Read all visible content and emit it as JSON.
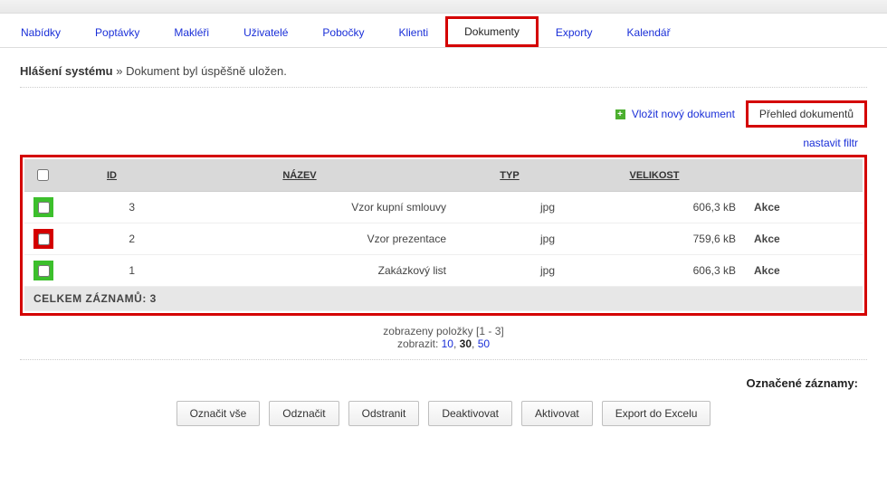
{
  "nav": {
    "items": [
      {
        "label": "Nabídky",
        "active": false
      },
      {
        "label": "Poptávky",
        "active": false
      },
      {
        "label": "Makléři",
        "active": false
      },
      {
        "label": "Uživatelé",
        "active": false
      },
      {
        "label": "Pobočky",
        "active": false
      },
      {
        "label": "Klienti",
        "active": false
      },
      {
        "label": "Dokumenty",
        "active": true
      },
      {
        "label": "Exporty",
        "active": false
      },
      {
        "label": "Kalendář",
        "active": false
      }
    ]
  },
  "sysmsg": {
    "title": "Hlášení systému",
    "sep": " » ",
    "text": "Dokument byl úspěšně uložen."
  },
  "top_actions": {
    "new_doc": "Vložit nový dokument",
    "overview": "Přehled dokumentů"
  },
  "filter": {
    "label": "nastavit filtr"
  },
  "columns": {
    "id": "ID",
    "name": "NÁZEV",
    "type": "TYP",
    "size": "VELIKOST",
    "action": "Akce"
  },
  "rows": [
    {
      "status": "green",
      "id": "3",
      "name": "Vzor kupní smlouvy",
      "type": "jpg",
      "size": "606,3 kB"
    },
    {
      "status": "red",
      "id": "2",
      "name": "Vzor prezentace",
      "type": "jpg",
      "size": "759,6 kB"
    },
    {
      "status": "green",
      "id": "1",
      "name": "Zakázkový list",
      "type": "jpg",
      "size": "606,3 kB"
    }
  ],
  "summary": {
    "label": "CELKEM ZÁZNAMŮ: ",
    "count": "3"
  },
  "pager": {
    "shown": "zobrazeny položky [1 - 3]",
    "show_label": "zobrazit: ",
    "opt10": "10",
    "opt30": "30",
    "opt50": "50"
  },
  "marked": {
    "label": "Označené záznamy:"
  },
  "buttons": {
    "select_all": "Označit vše",
    "deselect": "Odznačit",
    "delete": "Odstranit",
    "deactivate": "Deaktivovat",
    "activate": "Aktivovat",
    "export": "Export do Excelu"
  }
}
